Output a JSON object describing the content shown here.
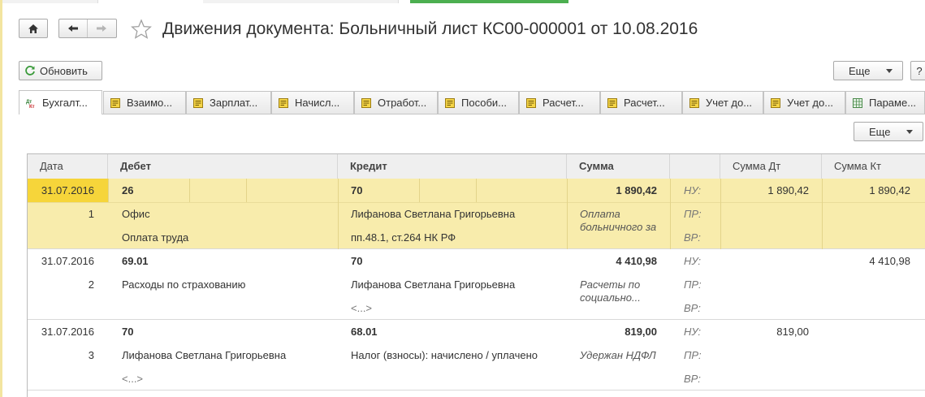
{
  "window": {
    "title": "Движения документа: Больничный лист КС00-000001 от 10.08.2016"
  },
  "toolbar": {
    "refresh_label": "Обновить",
    "more_label": "Еще",
    "help_label": "?"
  },
  "tabs": [
    {
      "label": "Бухгалт...",
      "icon": "dt-kt-icon",
      "active": true
    },
    {
      "label": "Взаимо...",
      "icon": "register-icon"
    },
    {
      "label": "Зарплат...",
      "icon": "register-icon"
    },
    {
      "label": "Начисл...",
      "icon": "register-icon"
    },
    {
      "label": "Отработ...",
      "icon": "register-icon"
    },
    {
      "label": "Пособи...",
      "icon": "register-icon"
    },
    {
      "label": "Расчет...",
      "icon": "register-icon"
    },
    {
      "label": "Расчет...",
      "icon": "register-icon"
    },
    {
      "label": "Учет до...",
      "icon": "register-icon"
    },
    {
      "label": "Учет до...",
      "icon": "register-icon"
    },
    {
      "label": "Параме...",
      "icon": "table-icon"
    }
  ],
  "panel": {
    "more_label": "Еще"
  },
  "table": {
    "columns": {
      "date": "Дата",
      "debit": "Дебет",
      "credit": "Кредит",
      "sum": "Сумма",
      "empty": "",
      "sum_dt": "Сумма Дт",
      "sum_kt": "Сумма Кт"
    },
    "rows": [
      {
        "date": "31.07.2016",
        "num": "1",
        "debit": [
          "26",
          "Офис",
          "Оплата труда"
        ],
        "credit": [
          "70",
          "Лифанова Светлана Григорьевна",
          "пп.48.1, ст.264 НК РФ"
        ],
        "sum": "1 890,42",
        "content": [
          "Оплата",
          "больничного за"
        ],
        "labels": [
          "НУ:",
          "ПР:",
          "ВР:"
        ],
        "sum_dt": "1 890,42",
        "sum_kt": "1 890,42"
      },
      {
        "date": "31.07.2016",
        "num": "2",
        "debit": [
          "69.01",
          "Расходы по страхованию",
          ""
        ],
        "credit": [
          "70",
          "Лифанова Светлана Григорьевна",
          "<...>"
        ],
        "sum": "4 410,98",
        "content": [
          "Расчеты по",
          "социально..."
        ],
        "labels": [
          "НУ:",
          "ПР:",
          "ВР:"
        ],
        "sum_dt": "",
        "sum_kt": "4 410,98"
      },
      {
        "date": "31.07.2016",
        "num": "3",
        "debit": [
          "70",
          "Лифанова Светлана Григорьевна",
          "<...>"
        ],
        "credit": [
          "68.01",
          "Налог (взносы): начислено / уплачено",
          ""
        ],
        "sum": "819,00",
        "content": [
          "Удержан НДФЛ",
          ""
        ],
        "labels": [
          "НУ:",
          "ПР:",
          "ВР:"
        ],
        "sum_dt": "819,00",
        "sum_kt": ""
      }
    ]
  }
}
